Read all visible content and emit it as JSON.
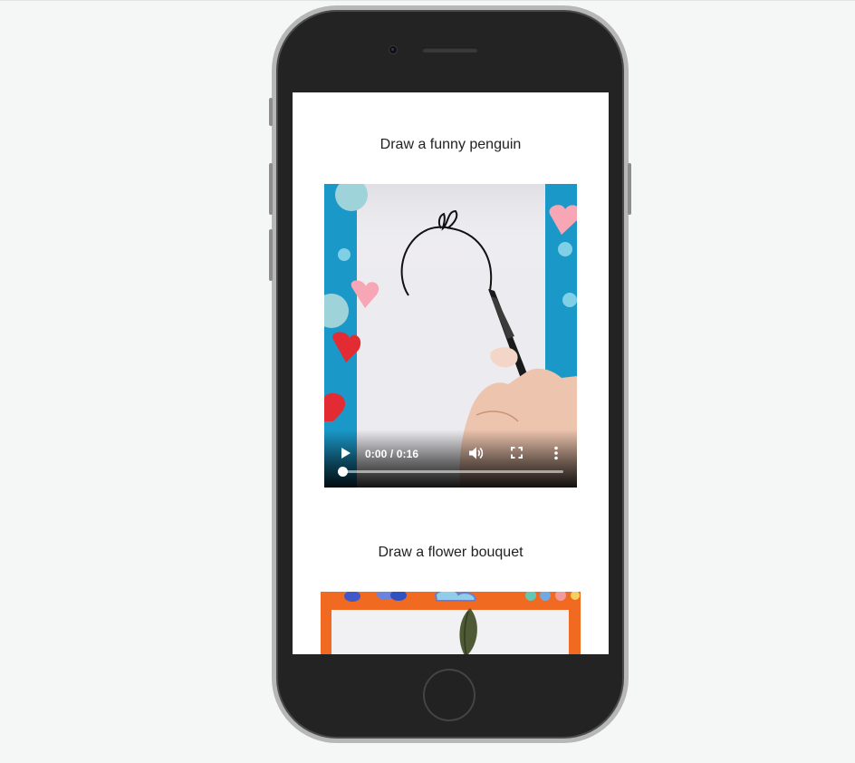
{
  "cards": [
    {
      "title": "Draw a funny penguin",
      "video": {
        "time_display": "0:00 / 0:16",
        "progress": 0,
        "controls": [
          "play-icon",
          "volume-icon",
          "fullscreen-icon",
          "more-options-icon"
        ]
      }
    },
    {
      "title": "Draw a flower bouquet"
    }
  ],
  "colors": {
    "page_background": "#f5f6f6",
    "phone_body": "#232323",
    "phone_bezel": "#b7b7b7",
    "screen": "#ffffff",
    "video1_background": "#1a99c9",
    "video2_background": "#f06a22"
  }
}
